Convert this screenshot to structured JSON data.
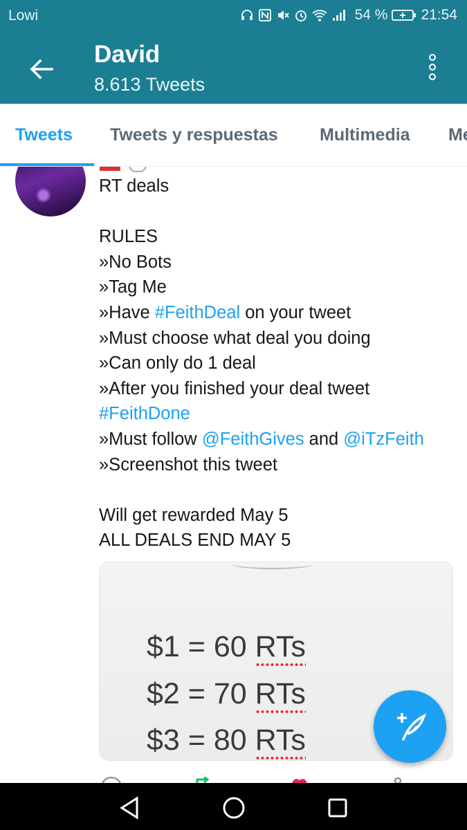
{
  "status_bar": {
    "carrier": "Lowi",
    "battery": "54 %",
    "time": "21:54",
    "icons": [
      "headset-icon",
      "nfc-icon",
      "mute-icon",
      "alarm-icon",
      "wifi-icon",
      "signal-icon",
      "battery-icon"
    ]
  },
  "app_bar": {
    "back_icon": "arrow-back-icon",
    "title": "David",
    "subtitle": "8.613 Tweets",
    "menu_icon": "more-vert-icon"
  },
  "tabs": [
    {
      "label": "Tweets",
      "active": true
    },
    {
      "label": "Tweets y respuestas",
      "active": false
    },
    {
      "label": "Multimedia",
      "active": false
    },
    {
      "label": "Me",
      "active": false
    }
  ],
  "tweet": {
    "lines": [
      [
        {
          "t": "RT deals"
        }
      ],
      [],
      [
        {
          "t": "RULES"
        }
      ],
      [
        {
          "t": "»No Bots"
        }
      ],
      [
        {
          "t": "»Tag Me"
        }
      ],
      [
        {
          "t": "»Have "
        },
        {
          "t": "#FeithDeal",
          "link": true
        },
        {
          "t": " on your tweet"
        }
      ],
      [
        {
          "t": "»Must choose what deal you doing"
        }
      ],
      [
        {
          "t": "»Can only do 1 deal"
        }
      ],
      [
        {
          "t": "»After you finished your deal tweet"
        }
      ],
      [
        {
          "t": "#FeithDone",
          "link": true
        }
      ],
      [
        {
          "t": "»Must follow "
        },
        {
          "t": "@FeithGives",
          "link": true
        },
        {
          "t": " and "
        },
        {
          "t": "@iTzFeith",
          "link": true
        }
      ],
      [
        {
          "t": "»Screenshot this tweet"
        }
      ],
      [],
      [
        {
          "t": "Will get rewarded May 5"
        }
      ],
      [
        {
          "t": "ALL DEALS END MAY 5"
        }
      ]
    ],
    "media_deals": [
      {
        "price": "$1 = 60 ",
        "unit": "RTs"
      },
      {
        "price": "$2 = 70 ",
        "unit": "RTs"
      },
      {
        "price": "$3 = 80 ",
        "unit": "RTs"
      }
    ]
  },
  "fab": {
    "icon": "compose-tweet-icon"
  },
  "nav_bar": {
    "icons": [
      "nav-back-icon",
      "nav-home-icon",
      "nav-recents-icon"
    ]
  },
  "colors": {
    "header": "#1b7e93",
    "accent": "#1da1f2",
    "text": "#14171a",
    "muted_tab": "#5a6a77"
  }
}
